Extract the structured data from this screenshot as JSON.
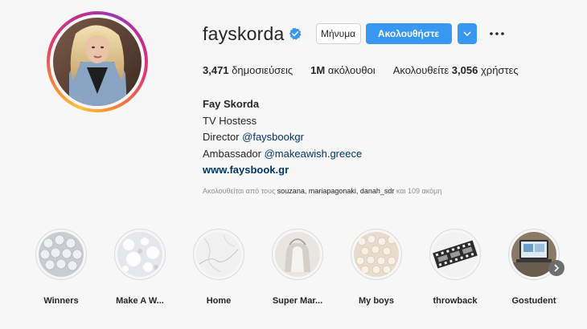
{
  "profile": {
    "username": "fayskorda",
    "verified_icon": "verified-badge-icon",
    "message_label": "Μήνυμα",
    "follow_label": "Ακολουθήστε",
    "dropdown_icon": "chevron-down-icon",
    "more_icon": "more-options-icon",
    "accent_color": "#3897f0",
    "verified_color": "#3897f0"
  },
  "stats": {
    "posts_count": "3,471",
    "posts_label": "δημοσιεύσεις",
    "followers_count": "1M",
    "followers_label": "ακόλουθοι",
    "following_prefix": "Ακολουθείτε",
    "following_count": "3,056",
    "following_suffix": "χρήστες"
  },
  "bio": {
    "full_name": "Fay Skorda",
    "line1": "TV Hostess",
    "line2_prefix": "Director",
    "line2_mention": "@faysbookgr",
    "line3_prefix": "Ambassador",
    "line3_mention": "@makeawish.greece",
    "website": "www.faysbook.gr"
  },
  "followed_by": {
    "prefix": "Ακολουθείται από τους",
    "users": "souzana, mariapagonaki, danah_sdr",
    "suffix": "και 109 ακόμη"
  },
  "highlights": [
    {
      "label": "Winners"
    },
    {
      "label": "Make A W..."
    },
    {
      "label": "Home"
    },
    {
      "label": "Super Mar..."
    },
    {
      "label": "My boys"
    },
    {
      "label": "throwback"
    },
    {
      "label": "Gostudent"
    }
  ],
  "next_icon": "chevron-right-icon"
}
